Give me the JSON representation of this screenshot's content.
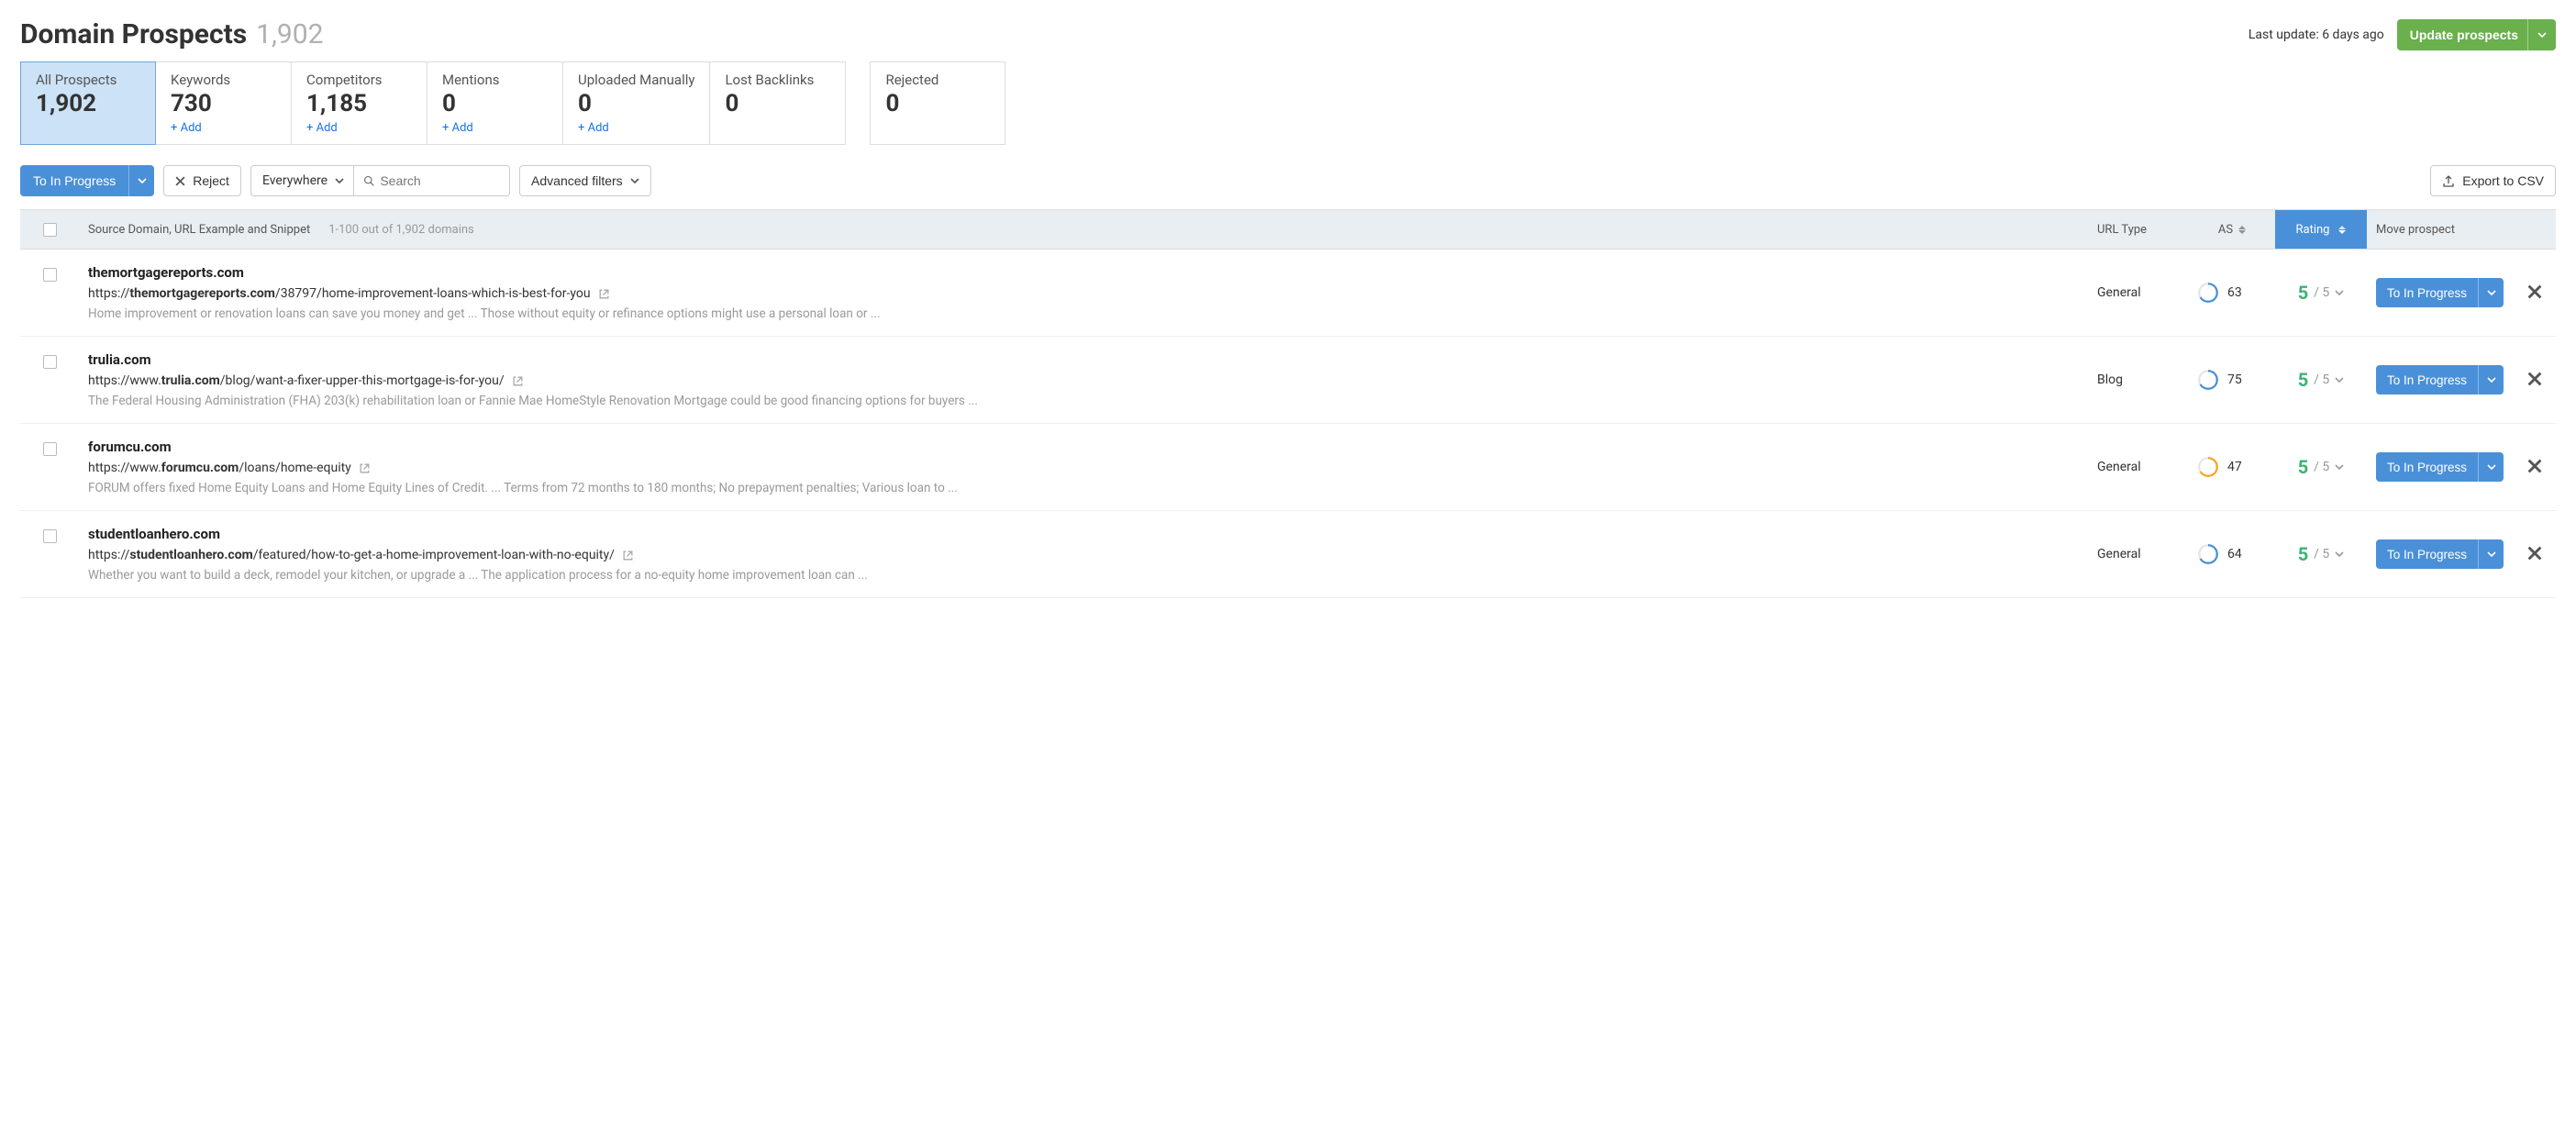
{
  "header": {
    "title": "Domain Prospects",
    "count": "1,902",
    "last_update": "Last update: 6 days ago",
    "update_button": "Update prospects"
  },
  "stats": [
    {
      "label": "All Prospects",
      "value": "1,902",
      "add": null,
      "selected": true
    },
    {
      "label": "Keywords",
      "value": "730",
      "add": "+ Add",
      "selected": false
    },
    {
      "label": "Competitors",
      "value": "1,185",
      "add": "+ Add",
      "selected": false
    },
    {
      "label": "Mentions",
      "value": "0",
      "add": "+ Add",
      "selected": false
    },
    {
      "label": "Uploaded Manually",
      "value": "0",
      "add": "+ Add",
      "selected": false
    },
    {
      "label": "Lost Backlinks",
      "value": "0",
      "add": null,
      "selected": false
    },
    {
      "label": "Rejected",
      "value": "0",
      "add": null,
      "selected": false,
      "separate": true
    }
  ],
  "toolbar": {
    "to_in_progress": "To In Progress",
    "reject": "Reject",
    "scope": "Everywhere",
    "search_placeholder": "Search",
    "advanced_filters": "Advanced filters",
    "export": "Export to CSV"
  },
  "table": {
    "columns": {
      "source": "Source Domain, URL Example and Snippet",
      "pagination": "1-100 out of 1,902 domains",
      "url_type": "URL Type",
      "as": "AS",
      "rating": "Rating",
      "move": "Move prospect"
    },
    "rows": [
      {
        "domain": "themortgagereports.com",
        "url_prefix": "https://",
        "url_bold": "themortgagereports.com",
        "url_suffix": "/38797/home-improvement-loans-which-is-best-for-you",
        "snippet": "Home improvement or renovation loans can save you money and get ... Those without equity or refinance options might use a personal loan or ...",
        "url_type": "General",
        "as": "63",
        "ring_color": "#4a90d9",
        "rating": "5",
        "rating_max": "/ 5",
        "action": "To In Progress"
      },
      {
        "domain": "trulia.com",
        "url_prefix": "https://www.",
        "url_bold": "trulia.com",
        "url_suffix": "/blog/want-a-fixer-upper-this-mortgage-is-for-you/",
        "snippet": "The Federal Housing Administration (FHA) 203(k) rehabilitation loan or Fannie Mae HomeStyle Renovation Mortgage could be good financing options for buyers ...",
        "url_type": "Blog",
        "as": "75",
        "ring_color": "#4a90d9",
        "rating": "5",
        "rating_max": "/ 5",
        "action": "To In Progress"
      },
      {
        "domain": "forumcu.com",
        "url_prefix": "https://www.",
        "url_bold": "forumcu.com",
        "url_suffix": "/loans/home-equity",
        "snippet": "FORUM offers fixed Home Equity Loans and Home Equity Lines of Credit. ... Terms from 72 months to 180 months; No prepayment penalties; Various loan to ...",
        "url_type": "General",
        "as": "47",
        "ring_color": "#f5a623",
        "rating": "5",
        "rating_max": "/ 5",
        "action": "To In Progress"
      },
      {
        "domain": "studentloanhero.com",
        "url_prefix": "https://",
        "url_bold": "studentloanhero.com",
        "url_suffix": "/featured/how-to-get-a-home-improvement-loan-with-no-equity/",
        "snippet": "Whether you want to build a deck, remodel your kitchen, or upgrade a ... The application process for a no-equity home improvement loan can ...",
        "url_type": "General",
        "as": "64",
        "ring_color": "#4a90d9",
        "rating": "5",
        "rating_max": "/ 5",
        "action": "To In Progress"
      }
    ]
  }
}
